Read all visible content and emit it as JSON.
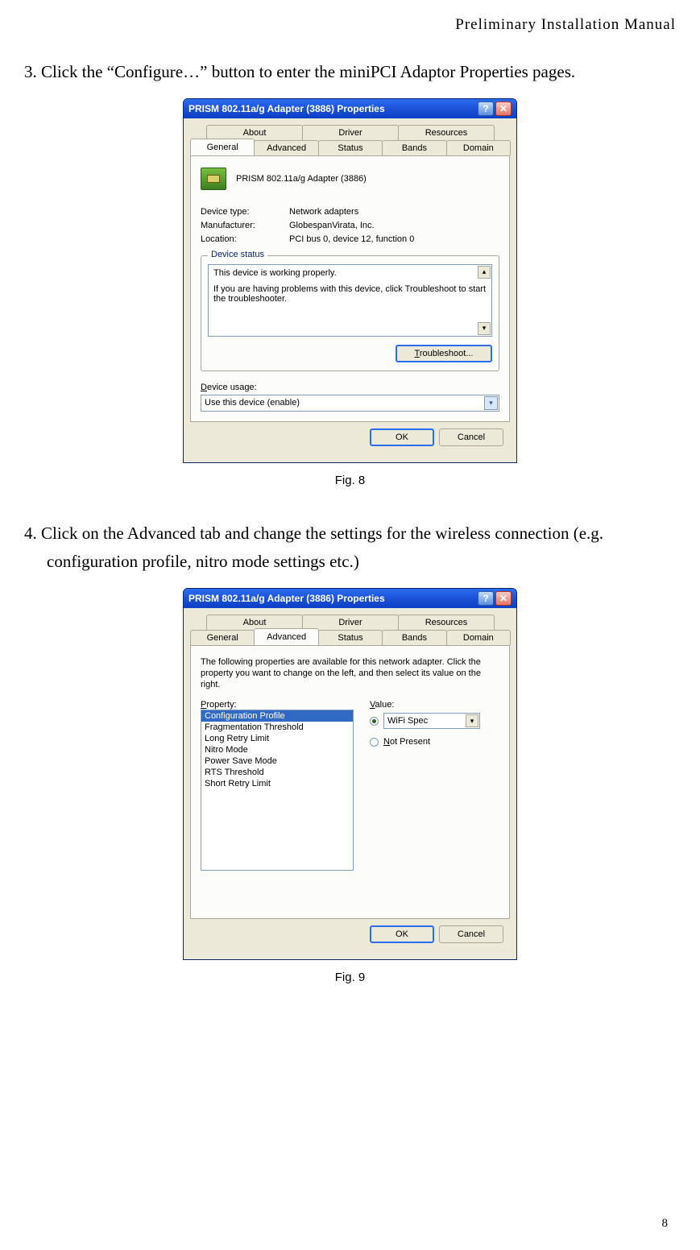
{
  "header": "Preliminary  Installation  Manual",
  "step3": {
    "num": "3.",
    "text": "Click the “Configure…” button to enter the miniPCI Adaptor Properties pages."
  },
  "step4": {
    "num": "4.",
    "text": "Click on the Advanced tab and change the settings for the wireless connection (e.g. configuration profile, nitro mode settings etc.)"
  },
  "fig8_caption": "Fig. 8",
  "fig9_caption": "Fig. 9",
  "page_num": "8",
  "dialog1": {
    "title": "PRISM 802.11a/g Adapter (3886) Properties",
    "tabs_back": [
      "About",
      "Driver",
      "Resources"
    ],
    "tabs_front": [
      "General",
      "Advanced",
      "Status",
      "Bands",
      "Domain"
    ],
    "selected_tab": "General",
    "device_name": "PRISM 802.11a/g Adapter (3886)",
    "rows": {
      "type_k": "Device type:",
      "type_v": "Network adapters",
      "mfr_k": "Manufacturer:",
      "mfr_v": "GlobespanVirata, Inc.",
      "loc_k": "Location:",
      "loc_v": "PCI bus 0, device 12, function 0"
    },
    "status_legend": "Device status",
    "status_line1": "This device is working properly.",
    "status_line2": "If you are having problems with this device, click Troubleshoot to start the troubleshooter.",
    "troubleshoot": "Troubleshoot...",
    "usage_label": "Device usage:",
    "usage_value": "Use this device (enable)",
    "ok": "OK",
    "cancel": "Cancel"
  },
  "dialog2": {
    "title": "PRISM 802.11a/g Adapter (3886) Properties",
    "tabs_back": [
      "About",
      "Driver",
      "Resources"
    ],
    "tabs_front": [
      "General",
      "Advanced",
      "Status",
      "Bands",
      "Domain"
    ],
    "selected_tab": "Advanced",
    "desc": "The following properties are available for this network adapter. Click the property you want to change on the left, and then select its value on the right.",
    "property_label": "Property:",
    "value_label": "Value:",
    "properties": [
      "Configuration Profile",
      "Fragmentation Threshold",
      "Long Retry Limit",
      "Nitro Mode",
      "Power Save Mode",
      "RTS Threshold",
      "Short Retry Limit"
    ],
    "selected_property": "Configuration Profile",
    "value": "WiFi Spec",
    "not_present": "Not Present",
    "ok": "OK",
    "cancel": "Cancel"
  }
}
